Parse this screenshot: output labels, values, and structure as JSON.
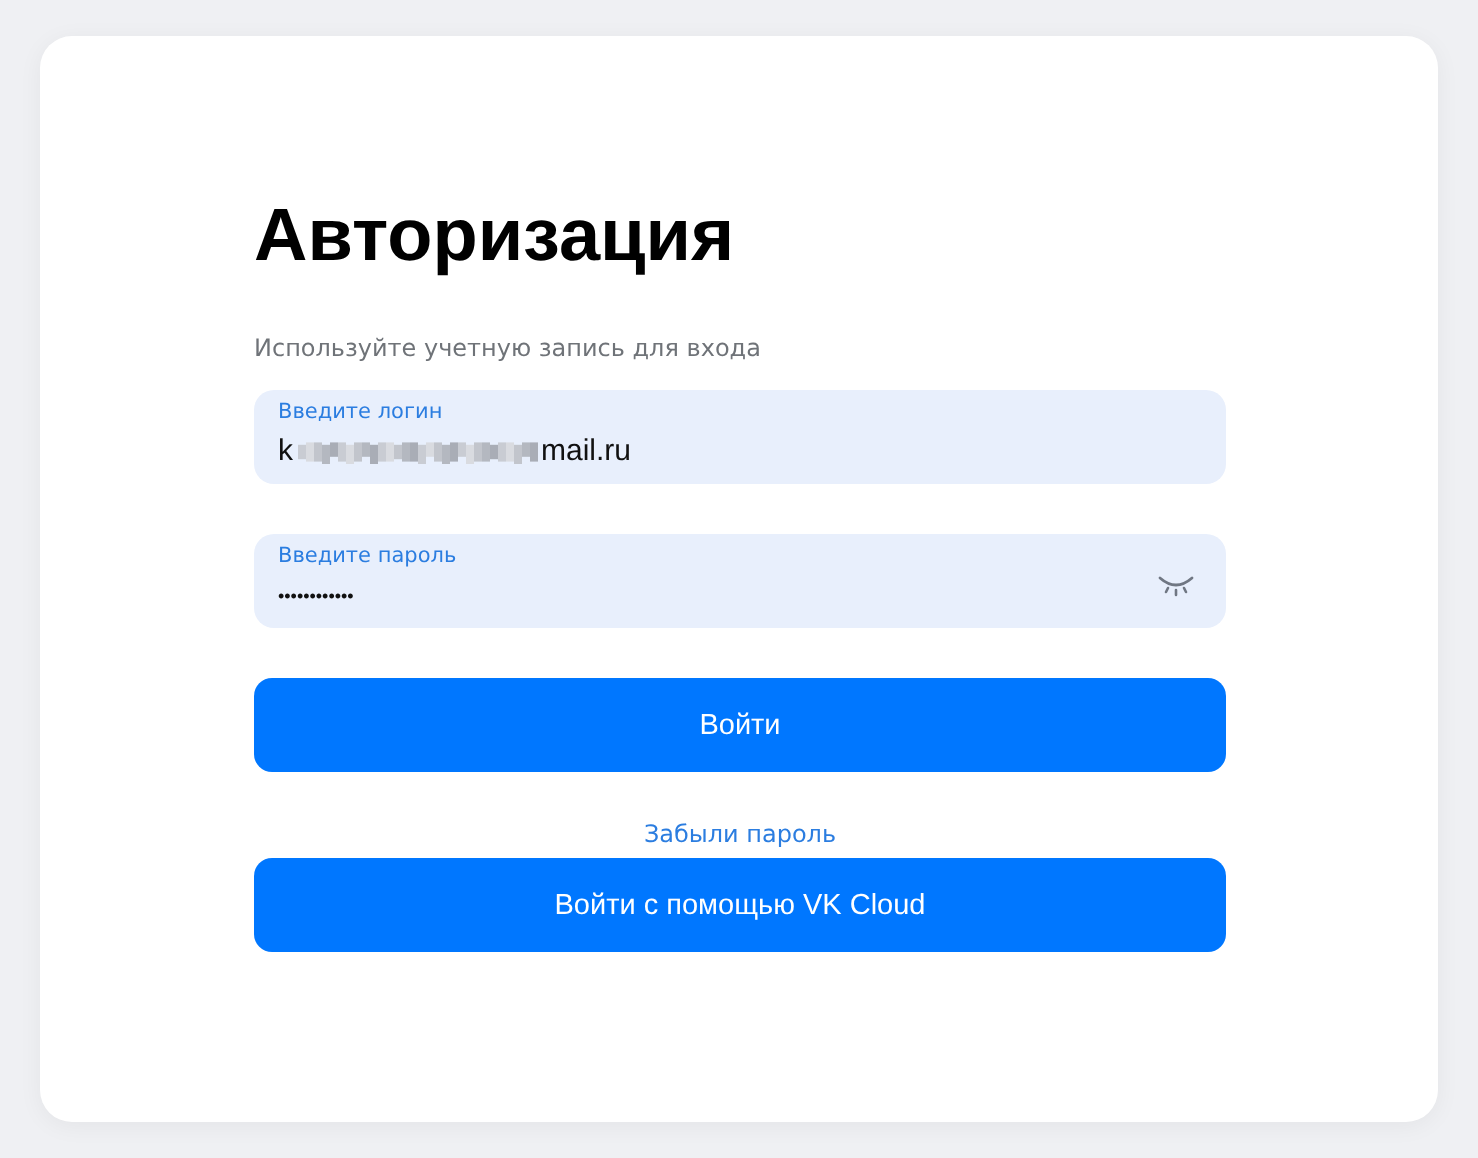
{
  "title": "Авторизация",
  "subtitle": "Используйте учетную запись для входа",
  "login_field": {
    "label": "Введите логин",
    "value_start": "k",
    "redacted": true,
    "value_end": "mail.ru"
  },
  "password_field": {
    "label": "Введите пароль",
    "value": "••••••••••••",
    "show_password_toggle": true
  },
  "login_button": "Войти",
  "forgot_link": "Забыли пароль",
  "vk_button": "Войти с помощью VK Cloud"
}
